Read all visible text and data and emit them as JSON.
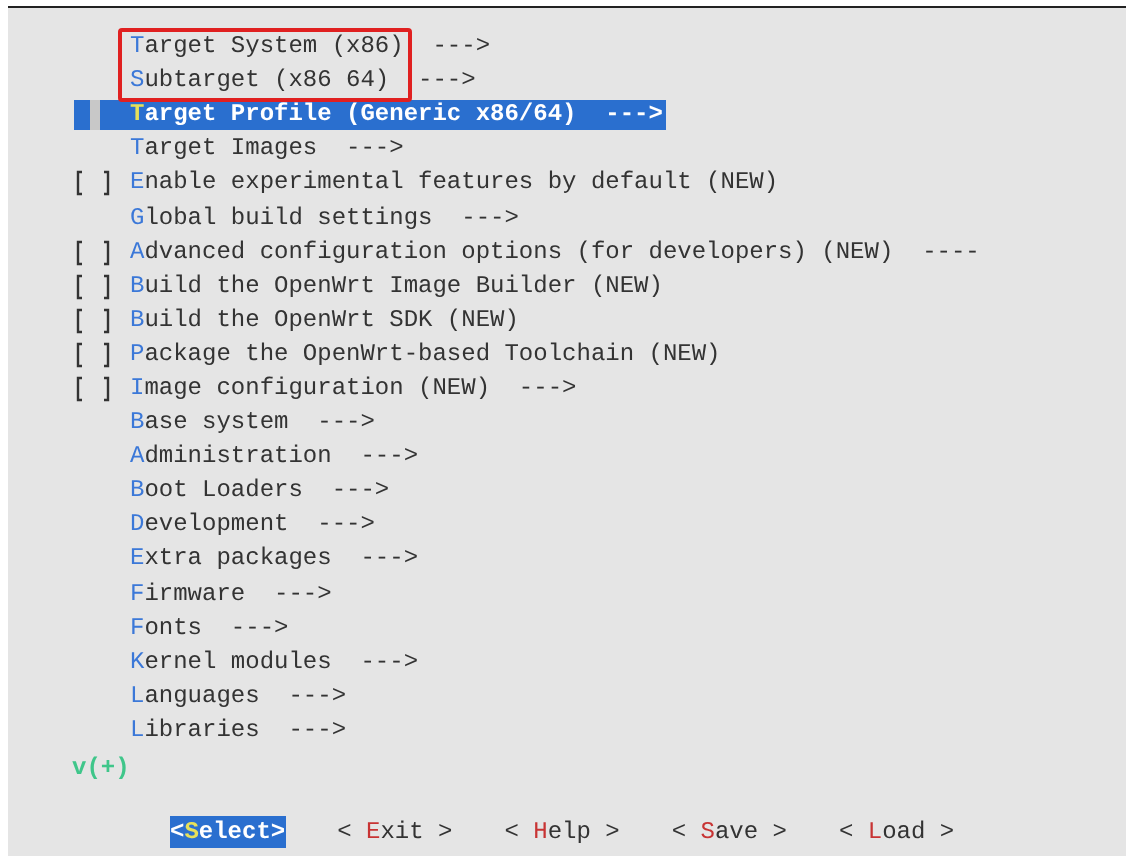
{
  "items": [
    {
      "kind": "menu",
      "label": "Target System (x86)",
      "arrow": "--->",
      "selected": false,
      "highlighted": true
    },
    {
      "kind": "menu",
      "label": "Subtarget (x86 64)",
      "arrow": "--->",
      "selected": false,
      "highlighted": true
    },
    {
      "kind": "menu",
      "label": "Target Profile (Generic x86/64)",
      "arrow": "--->",
      "selected": true,
      "highlighted": false
    },
    {
      "kind": "menu",
      "label": "Target Images",
      "arrow": "--->",
      "selected": false,
      "highlighted": false
    },
    {
      "kind": "checkbox",
      "label": "Enable experimental features by default (NEW)",
      "checked": false,
      "selected": false,
      "highlighted": false
    },
    {
      "kind": "menu",
      "label": "Global build settings",
      "arrow": "--->",
      "selected": false,
      "highlighted": false
    },
    {
      "kind": "checkbox",
      "label": "Advanced configuration options (for developers) (NEW)",
      "arrow": "----",
      "checked": false,
      "selected": false,
      "highlighted": false
    },
    {
      "kind": "checkbox",
      "label": "Build the OpenWrt Image Builder (NEW)",
      "checked": false,
      "selected": false,
      "highlighted": false
    },
    {
      "kind": "checkbox",
      "label": "Build the OpenWrt SDK (NEW)",
      "checked": false,
      "selected": false,
      "highlighted": false
    },
    {
      "kind": "checkbox",
      "label": "Package the OpenWrt-based Toolchain (NEW)",
      "checked": false,
      "selected": false,
      "highlighted": false
    },
    {
      "kind": "checkbox",
      "label": "Image configuration (NEW)",
      "arrow": "--->",
      "checked": false,
      "selected": false,
      "highlighted": false
    },
    {
      "kind": "menu",
      "label": "Base system",
      "arrow": "--->",
      "selected": false,
      "highlighted": false
    },
    {
      "kind": "menu",
      "label": "Administration",
      "arrow": "--->",
      "selected": false,
      "highlighted": false
    },
    {
      "kind": "menu",
      "label": "Boot Loaders",
      "arrow": "--->",
      "selected": false,
      "highlighted": false
    },
    {
      "kind": "menu",
      "label": "Development",
      "arrow": "--->",
      "selected": false,
      "highlighted": false
    },
    {
      "kind": "menu",
      "label": "Extra packages",
      "arrow": "--->",
      "selected": false,
      "highlighted": false
    },
    {
      "kind": "menu",
      "label": "Firmware",
      "arrow": "--->",
      "selected": false,
      "highlighted": false
    },
    {
      "kind": "menu",
      "label": "Fonts",
      "arrow": "--->",
      "selected": false,
      "highlighted": false
    },
    {
      "kind": "menu",
      "label": "Kernel modules",
      "arrow": "--->",
      "selected": false,
      "highlighted": false
    },
    {
      "kind": "menu",
      "label": "Languages",
      "arrow": "--->",
      "selected": false,
      "highlighted": false
    },
    {
      "kind": "menu",
      "label": "Libraries",
      "arrow": "--->",
      "selected": false,
      "highlighted": false
    }
  ],
  "more_indicator": "v(+)",
  "buttons": [
    {
      "left": "<",
      "label": "Select",
      "right": ">",
      "selected": true
    },
    {
      "left": "< ",
      "label": "Exit",
      "right": " >",
      "selected": false
    },
    {
      "left": "< ",
      "label": "Help",
      "right": " >",
      "selected": false
    },
    {
      "left": "< ",
      "label": "Save",
      "right": " >",
      "selected": false
    },
    {
      "left": "< ",
      "label": "Load",
      "right": " >",
      "selected": false
    }
  ]
}
